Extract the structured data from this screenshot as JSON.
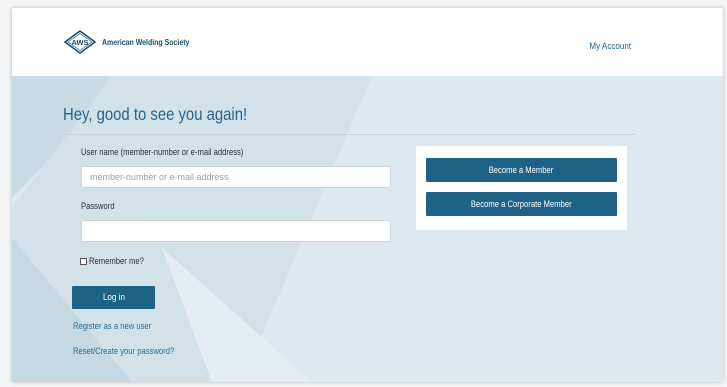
{
  "header": {
    "logo_mark": "AWS",
    "logo_text": "American Welding Society",
    "my_account": "My Account"
  },
  "main": {
    "heading": "Hey, good to see you again!",
    "username_label": "User name (member-number or e-mail address)",
    "username_placeholder": "member-number or e-mail address",
    "username_value": "",
    "password_label": "Password",
    "password_value": "",
    "remember_label": "Remember me?",
    "remember_checked": false,
    "login_button": "Log in",
    "register_link": "Register as a new user",
    "reset_link": "Reset/Create your password?"
  },
  "side": {
    "become_member": "Become a Member",
    "become_corporate": "Become a Corporate Member"
  },
  "colors": {
    "brand_blue": "#1e6285",
    "heading_blue": "#24648c",
    "background": "#dde9ee"
  }
}
